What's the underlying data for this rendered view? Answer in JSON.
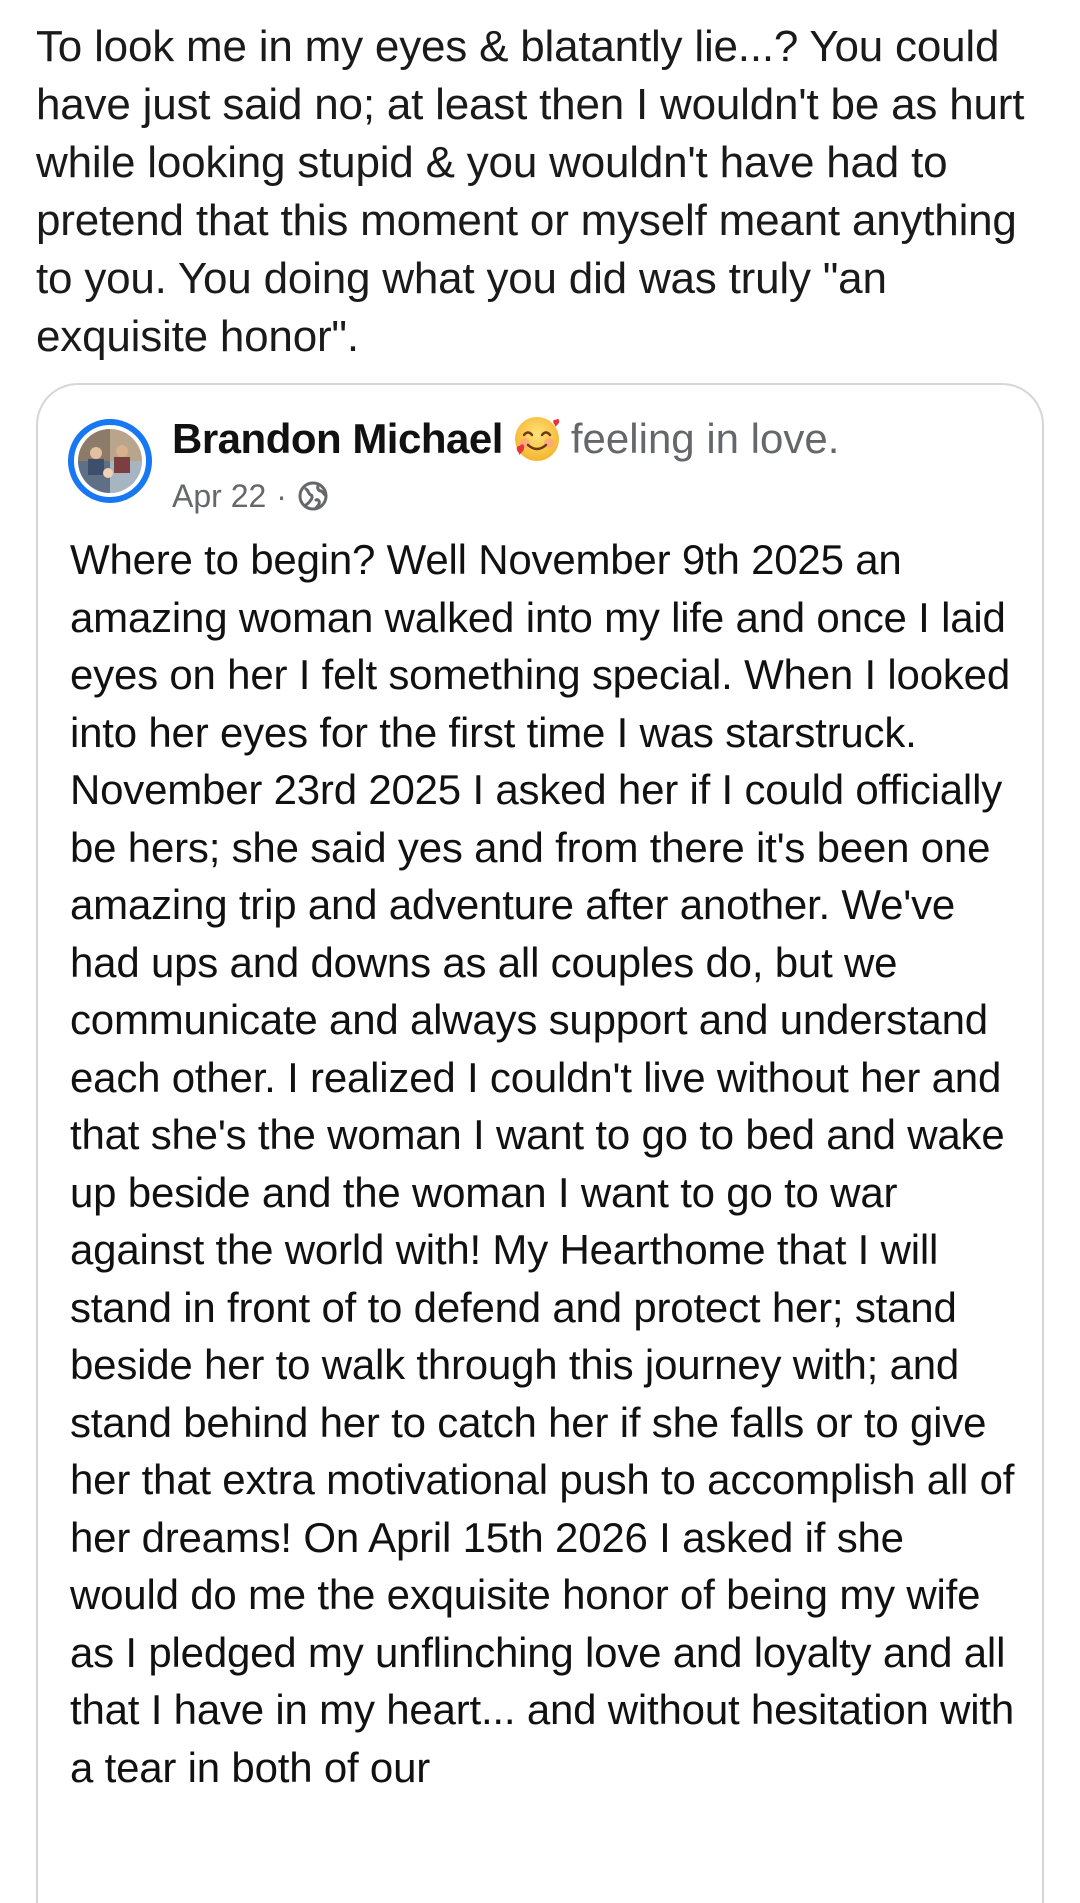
{
  "caption": "To look me in my eyes & blatantly lie...? You could have just said no; at least then I wouldn't be as hurt while looking stupid & you wouldn't have had to pretend that this moment or myself meant anything to you. You doing what you did was truly \"an exquisite honor\".",
  "shared_post": {
    "author": "Brandon Michael",
    "emoji": "smiling-face-with-hearts",
    "feeling": "feeling in love.",
    "date": "Apr 22",
    "separator": "·",
    "audience_icon": "globe-icon",
    "body": "Where to begin? Well November 9th 2025 an amazing woman walked into my life and once I laid eyes on her I felt something special. When I looked into her eyes for the first time I was starstruck. November 23rd 2025 I asked her if I could officially be hers; she said yes and from there it's been one amazing trip and adventure after another. We've had ups and downs as all couples do, but we communicate and always support and understand each other. I realized I couldn't live without her and that she's the woman I want to go to bed and wake up beside and the woman I want to go to war against the world with! My Hearthome that I will stand in front of to defend and protect her; stand beside her to walk through this journey with; and stand behind her to catch her if she falls or to give her that extra motivational push to accomplish all of her dreams! On April 15th 2026 I asked if she would do me the exquisite honor of being my wife as I pledged my unflinching love and loyalty and all that I have in my heart... and without hesitation with a tear in both of our"
  },
  "colors": {
    "accent_blue": "#1877f2",
    "secondary_text": "#65676b",
    "card_border": "#d6d6d6"
  }
}
